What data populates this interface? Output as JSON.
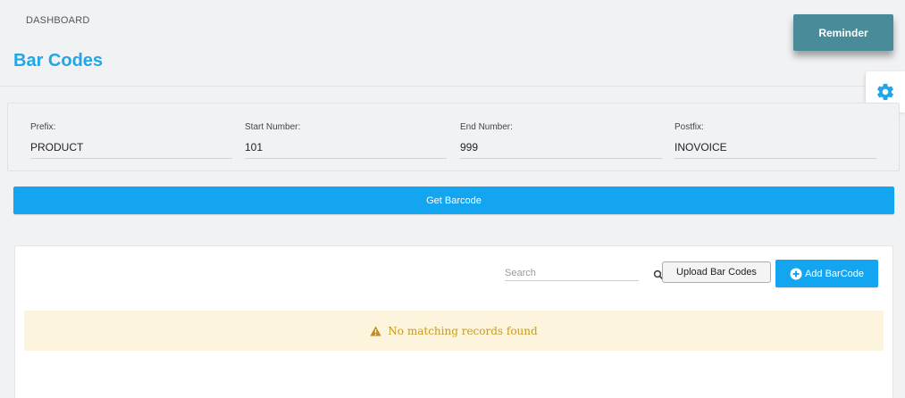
{
  "header": {
    "breadcrumb": "DASHBOARD",
    "title": "Bar Codes",
    "reminder_label": "Reminder",
    "settings_icon": "gear-icon"
  },
  "form": {
    "prefix": {
      "label": "Prefix:",
      "value": "PRODUCT"
    },
    "start_number": {
      "label": "Start Number:",
      "value": "101"
    },
    "end_number": {
      "label": "End Number:",
      "value": "999"
    },
    "postfix": {
      "label": "Postfix:",
      "value": "INOVOICE"
    },
    "submit_label": "Get Barcode"
  },
  "table_toolbar": {
    "search_placeholder": "Search",
    "search_value": "",
    "search_icon": "search-icon",
    "upload_label": "Upload Bar Codes",
    "add_label": "Add BarCode",
    "add_icon": "plus-circle-icon"
  },
  "empty_state": {
    "message": "No matching records found",
    "icon": "warning-icon"
  },
  "colors": {
    "accent": "#13a5ef",
    "title": "#21a6e8",
    "reminder": "#4a8b9a",
    "warning_bg": "#fcf4dc",
    "warning_text": "#c89a1e"
  }
}
